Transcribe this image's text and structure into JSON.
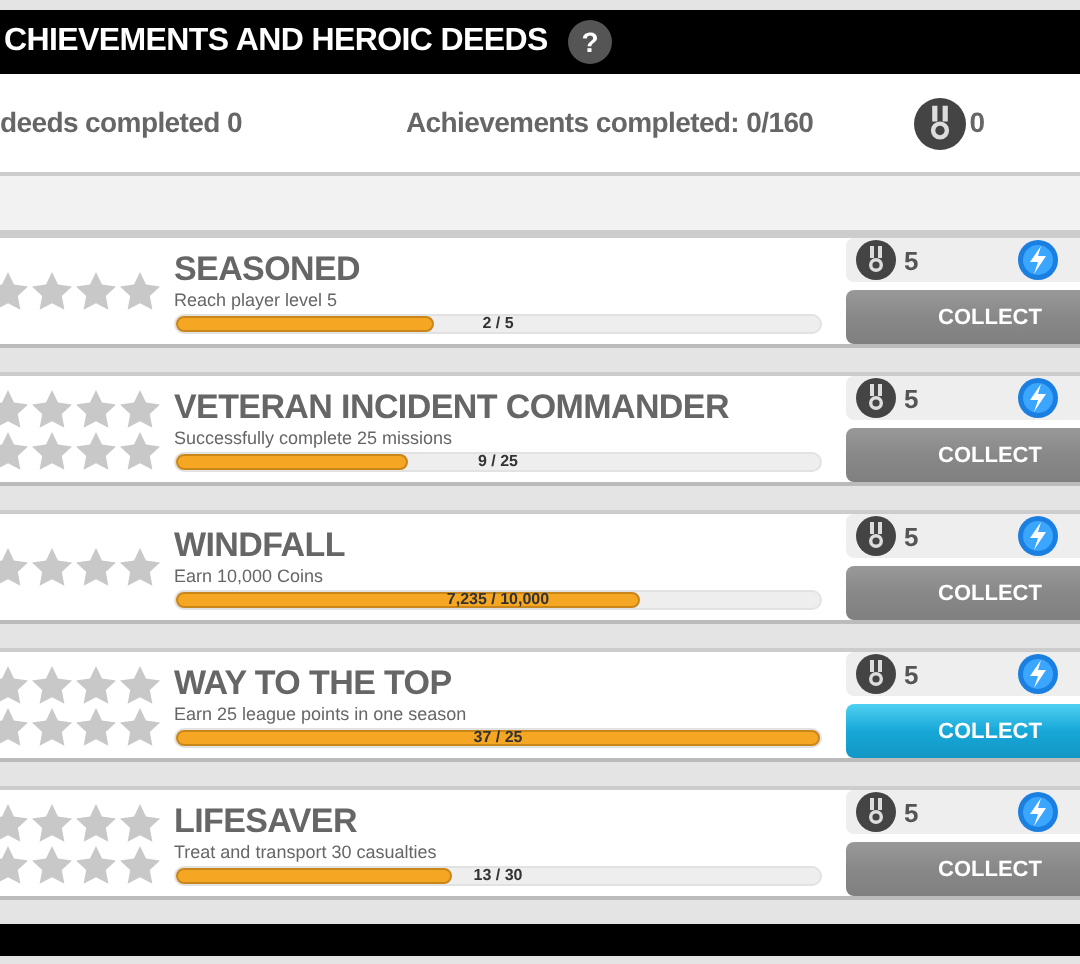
{
  "header": {
    "title": "CHIEVEMENTS AND HEROIC DEEDS",
    "help": "?"
  },
  "stats": {
    "deeds": "deeds completed 0",
    "achievements": "Achievements completed: 0/160",
    "medals": "0"
  },
  "achievements": [
    {
      "title": "SEASONED",
      "description": "Reach player level 5",
      "progress": "2 / 5",
      "level": 0.4,
      "star_rows": [
        {
          "stars": 0
        }
      ],
      "reward": "5",
      "collect": "COLLECT",
      "disabled": true
    },
    {
      "title": "VETERAN INCIDENT COMMANDER",
      "description": "Successfully complete 25 missions",
      "progress": "9 / 25",
      "level": 0.36,
      "star_rows": [
        {
          "stars": 0
        },
        {
          "stars": 0
        }
      ],
      "reward": "5",
      "collect": "COLLECT",
      "disabled": true
    },
    {
      "title": "WINDFALL",
      "description": "Earn 10,000 Coins",
      "progress": "7,235 / 10,000",
      "level": 0.72,
      "star_rows": [
        {
          "stars": 0
        }
      ],
      "reward": "5",
      "collect": "COLLECT",
      "disabled": true
    },
    {
      "title": "WAY TO THE TOP",
      "description": "Earn 25 league points in one season",
      "progress": "37 / 25",
      "level": 1,
      "star_rows": [
        {
          "stars": 0
        },
        {
          "stars": 0
        }
      ],
      "reward": "5",
      "collect": "COLLECT",
      "disabled": false
    },
    {
      "title": "LIFESAVER",
      "description": "Treat and transport 30 casualties",
      "progress": "13 / 30",
      "level": 0.43,
      "star_rows": [
        {
          "stars": 0
        },
        {
          "stars": 0
        }
      ],
      "reward": "5",
      "collect": "COLLECT",
      "disabled": true
    }
  ]
}
